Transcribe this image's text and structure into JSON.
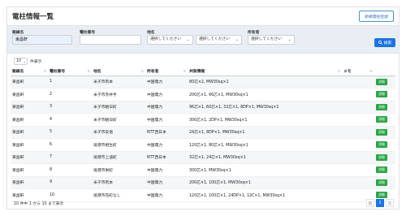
{
  "header": {
    "title": "電柱情報一覧",
    "new_button": "新規電柱登録"
  },
  "filters": {
    "route": {
      "label": "路線名",
      "value": "東昌軒"
    },
    "pole_number": {
      "label": "電柱番号",
      "value": ""
    },
    "area": {
      "label": "地名",
      "select1": "選択してください",
      "select2": "選択してください"
    },
    "owner": {
      "label": "所有者",
      "select": "選択してください"
    },
    "search_button": "検索"
  },
  "length": {
    "value": "10",
    "suffix": "件表示"
  },
  "table": {
    "columns": [
      "路線名",
      "電柱番号",
      "地名",
      "所有者",
      "共架情報",
      "メモ",
      ""
    ],
    "rows": [
      [
        "東昌軒",
        "1",
        "米子市両本",
        "中国電力",
        "80芯×2, MW30sq×1",
        "",
        "詳細"
      ],
      [
        "東昌軒",
        "2",
        "米子市赤井手",
        "中国電力",
        "200芯×1, 66芯×1, MW30sq×1",
        "",
        "詳細"
      ],
      [
        "東昌軒",
        "3",
        "米子市観日町",
        "中国電力",
        "96芯×1, 60芯×1, 32芯×1, 8DP×1, MW30sq×1",
        "",
        "詳細"
      ],
      [
        "東昌軒",
        "4",
        "米子市観日町",
        "中国電力",
        "300芯×1, 2DP×1, MW30sq×1",
        "",
        "詳細"
      ],
      [
        "東昌軒",
        "5",
        "米子市安倍",
        "NTT西日本",
        "24芯×1, 8DP×1, MW30sq×1",
        "",
        "詳細"
      ],
      [
        "東昌軒",
        "6",
        "境港市相生町",
        "中国電力",
        "120芯×1, 80芯×1, MW30sq×1",
        "",
        "詳細"
      ],
      [
        "東昌軒",
        "7",
        "境港市上道町",
        "NTT西日本",
        "32芯×1, 24芯×1, MW30sq×1",
        "",
        "詳細"
      ],
      [
        "東昌軒",
        "8",
        "境港市栄町",
        "中国電力",
        "300芯×1, MW30sq×1",
        "",
        "詳細"
      ],
      [
        "東昌軒",
        "9",
        "米子市両本",
        "中国電力",
        "200芯×1, 100芯×1, MW30sq×1",
        "",
        "詳細"
      ],
      [
        "東昌軒",
        "10",
        "境港市花町なし",
        "中国電力",
        "120芯×1, 100芯×1, 24DP×1, 12C×1, MW30sq×1",
        "",
        "詳細"
      ]
    ]
  },
  "footer": {
    "info": "10 件中 1 から 10 まで表示",
    "prev": "前",
    "page": "1",
    "next": "次"
  },
  "colors": {
    "accent": "#1a73e8",
    "detail": "#28a745",
    "panel": "#e9eef4"
  }
}
